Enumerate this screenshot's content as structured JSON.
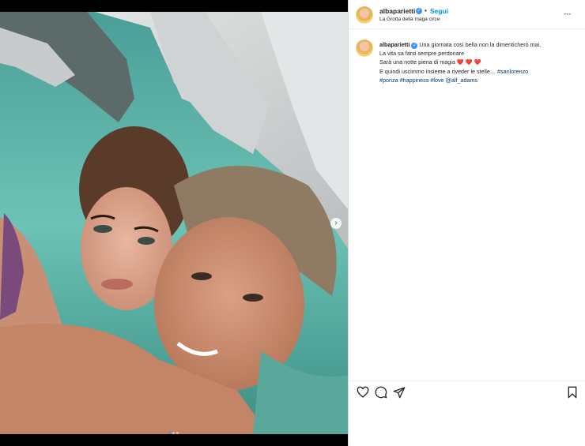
{
  "post": {
    "username": "albaparietti",
    "verified_badge": "✓",
    "separator": "•",
    "follow_label": "Segui",
    "location": "La Grotta della maga circe",
    "more_icon": "more-dots-icon",
    "more_glyph": "···"
  },
  "caption": {
    "username": "albaparietti",
    "line1": "Una giornata così bella non la dimenticherò mai.",
    "line2": "La vita sa farsi sempre perdonare",
    "line3": "Sarà una notte piena di magia",
    "hearts": "❤️ ❤️ ❤️",
    "line4": "E quindi uscimmo insieme a riveder le stelle…",
    "hashtag1": "#sanlorenzo",
    "hashtag2": "#ponza",
    "hashtag3": "#happiness",
    "hashtag4": "#love",
    "mention": "@alf_adams"
  },
  "carousel": {
    "next_glyph": "›",
    "slides": 3,
    "active": 0
  },
  "actions": {
    "like_icon": "heart-icon",
    "comment_icon": "comment-icon",
    "share_icon": "share-icon",
    "save_icon": "bookmark-icon"
  },
  "colors": {
    "link": "#0095f6",
    "hashtag": "#00376b",
    "verified": "#3897f0",
    "water": "#5fb8ad",
    "rock": "#d9dcdc"
  }
}
